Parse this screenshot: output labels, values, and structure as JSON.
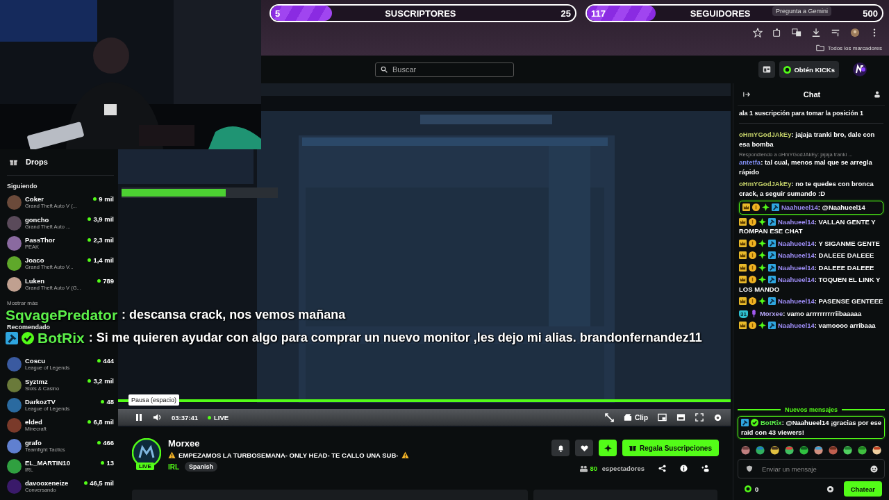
{
  "browser": {
    "goal_bars": [
      {
        "count": "5",
        "label": "SUSCRIPTORES",
        "goal": "25",
        "level": 0.2
      },
      {
        "count": "117",
        "label": "SEGUIDORES",
        "goal": "500",
        "level": 0.234
      }
    ],
    "gemini_hint": "Pregunta a Gemini",
    "bookmarks": "Todos los marcadores"
  },
  "topbar": {
    "search": {
      "placeholder": "Buscar"
    },
    "kicks_button": "Obtén KICKs"
  },
  "sidebar": {
    "drops": "Drops",
    "following": {
      "title": "Siguiendo",
      "channels": [
        {
          "name": "Coker",
          "game": "Grand Theft Auto V (...",
          "viewers": "9 mil"
        },
        {
          "name": "goncho",
          "game": "Grand Theft Auto ...",
          "viewers": "3,9 mil"
        },
        {
          "name": "PassThor",
          "game": "PEAK",
          "viewers": "2,3 mil"
        },
        {
          "name": "Joaco",
          "game": "Grand Theft Auto V...",
          "viewers": "1,4 mil"
        },
        {
          "name": "Luken",
          "game": "Grand Theft Auto V (G...",
          "viewers": "789"
        }
      ]
    },
    "show_more": "Mostrar más",
    "recommended": {
      "title": "Recomendado",
      "channels": [
        {
          "name": "Coscu",
          "game": "League of Legends",
          "viewers": "444"
        },
        {
          "name": "Syztmz",
          "game": "Slots & Casino",
          "viewers": "3,2 mil"
        },
        {
          "name": "DarkozTV",
          "game": "League of Legends",
          "viewers": "48"
        },
        {
          "name": "elded",
          "game": "Minecraft",
          "viewers": "6,8 mil"
        },
        {
          "name": "grafo",
          "game": "Teamfight Tactics",
          "viewers": "466"
        },
        {
          "name": "EL_MARTIN10",
          "game": "IRL",
          "viewers": "13"
        },
        {
          "name": "davooxeneize",
          "game": "Conversando",
          "viewers": "46,5 mil"
        }
      ]
    }
  },
  "overlay_chat": [
    {
      "user": "SqvagePredator",
      "text": ": descansa crack, nos vemos mañana"
    },
    {
      "user": "BotRix",
      "text": ": Si me quieren ayudar con algo para comprar un nuevo monitor ,les dejo mi alias. brandonfernandez11",
      "badges": [
        {
          "kind": "hammer"
        },
        {
          "kind": "verified"
        }
      ]
    }
  ],
  "player": {
    "tooltip": "Pausa (espacio)",
    "time": "03:37:41",
    "live": "LIVE",
    "clip": "Clip"
  },
  "stream": {
    "name": "Morxee",
    "live_badge": "LIVE",
    "title": "EMPEZAMOS LA TURBOSEMANA- ONLY HEAD- TE CALLO UNA SUB-",
    "category": "IRL",
    "tags": [
      "Spanish"
    ],
    "gift_button": "Regala Suscripciones",
    "viewers": "80",
    "viewers_label": "espectadores"
  },
  "chat": {
    "title": "Chat",
    "pinned": "ala 1 suscripción para tomar la posición 1",
    "messages": [
      {
        "kind": "normal",
        "user": "oHmYGodJAkEy",
        "color": "#c6d36a",
        "text": ": jajaja tranki bro, dale con esa bomba"
      },
      {
        "kind": "reply",
        "reply_to": "Respondiendo a oHmYGodJAkEy: jajaja tranki ...",
        "user": "antetfa",
        "color": "#7f8cf0",
        "text": ": tal cual, menos mal que se arregla rápido"
      },
      {
        "kind": "normal",
        "user": "oHmYGodJAkEy",
        "color": "#c6d36a",
        "text": ": no te quedes con bronca crack, a seguir sumando :D"
      },
      {
        "kind": "mention",
        "badges": [
          {
            "kind": "crown"
          },
          {
            "kind": "coin"
          },
          {
            "kind": "gem"
          },
          {
            "kind": "hammer"
          }
        ],
        "user": "Naahueel14",
        "color": "#9d8cf5",
        "text": ": @Naahueel14"
      },
      {
        "kind": "normal",
        "badges": [
          {
            "kind": "crown"
          },
          {
            "kind": "coin"
          },
          {
            "kind": "gem"
          },
          {
            "kind": "hammer"
          }
        ],
        "user": "Naahueel14",
        "color": "#9d8cf5",
        "text": ": VALLAN GENTE Y ROMPAN ESE CHAT"
      },
      {
        "kind": "normal",
        "badges": [
          {
            "kind": "crown"
          },
          {
            "kind": "coin"
          },
          {
            "kind": "gem"
          },
          {
            "kind": "hammer"
          }
        ],
        "user": "Naahueel14",
        "color": "#9d8cf5",
        "text": ": Y SIGANME GENTE"
      },
      {
        "kind": "normal",
        "badges": [
          {
            "kind": "crown"
          },
          {
            "kind": "coin"
          },
          {
            "kind": "gem"
          },
          {
            "kind": "hammer"
          }
        ],
        "user": "Naahueel14",
        "color": "#9d8cf5",
        "text": ": DALEEE DALEEE"
      },
      {
        "kind": "normal",
        "badges": [
          {
            "kind": "crown"
          },
          {
            "kind": "coin"
          },
          {
            "kind": "gem"
          },
          {
            "kind": "hammer"
          }
        ],
        "user": "Naahueel14",
        "color": "#9d8cf5",
        "text": ": DALEEE DALEEE"
      },
      {
        "kind": "normal",
        "badges": [
          {
            "kind": "crown"
          },
          {
            "kind": "coin"
          },
          {
            "kind": "gem"
          },
          {
            "kind": "hammer"
          }
        ],
        "user": "Naahueel14",
        "color": "#9d8cf5",
        "text": ": TOQUEN EL LINK Y LOS MANDO"
      },
      {
        "kind": "normal",
        "badges": [
          {
            "kind": "crown"
          },
          {
            "kind": "coin"
          },
          {
            "kind": "gem"
          },
          {
            "kind": "hammer"
          }
        ],
        "user": "Naahueel14",
        "color": "#9d8cf5",
        "text": ": PASENSE GENTEEE"
      },
      {
        "kind": "normal",
        "badges": [
          {
            "kind": "shield",
            "text": "31"
          },
          {
            "kind": "mic"
          }
        ],
        "user": "Morxee",
        "color": "#b3a4f5",
        "text": ": vamo arrrrrrrrrriibaaaaa"
      },
      {
        "kind": "normal",
        "badges": [
          {
            "kind": "crown"
          },
          {
            "kind": "coin"
          },
          {
            "kind": "gem"
          },
          {
            "kind": "hammer"
          }
        ],
        "user": "Naahueel14",
        "color": "#9d8cf5",
        "text": ": vamoooo arribaaa"
      }
    ],
    "new_messages": "Nuevos mensajes",
    "latest": {
      "badges": [
        {
          "kind": "hammer"
        },
        {
          "kind": "verified"
        }
      ],
      "user": "BotRix",
      "color": "#5cf04a",
      "text": ": @Naahueel14 ¡gracias por ese raid con 43 viewers!"
    },
    "input": {
      "placeholder": "Enviar un mensaje"
    },
    "kicks": "0",
    "send_button": "Chatear"
  }
}
